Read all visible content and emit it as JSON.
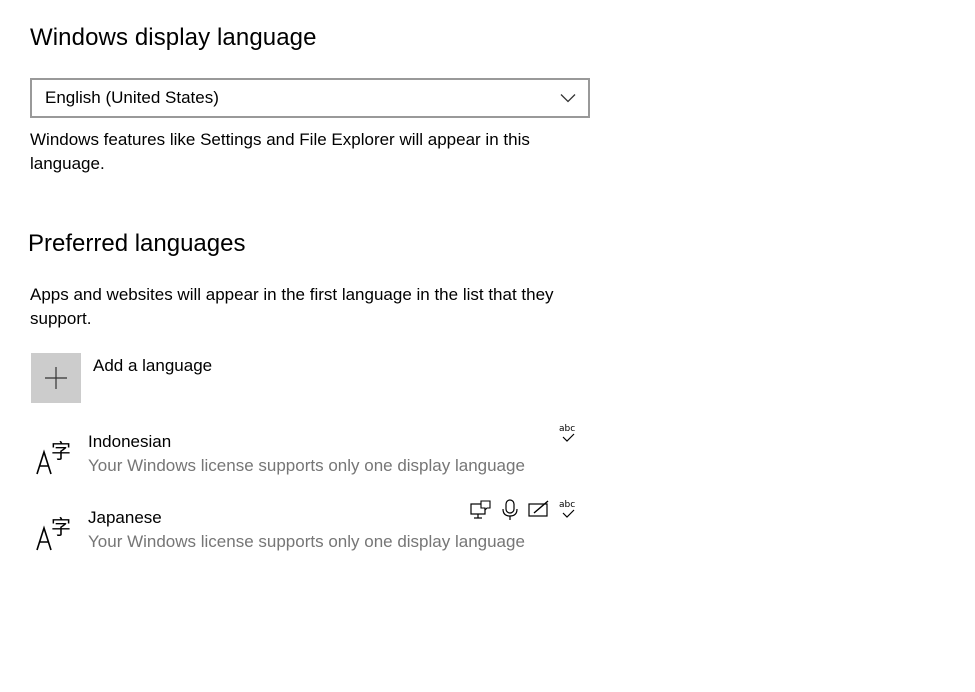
{
  "display_language": {
    "heading": "Windows display language",
    "selected": "English (United States)",
    "description": "Windows features like Settings and File Explorer will appear in this language."
  },
  "preferred_languages": {
    "heading": "Preferred languages",
    "description": "Apps and websites will appear in the first language in the list that they support.",
    "add_label": "Add a language",
    "languages": [
      {
        "name": "Indonesian",
        "note": "Your Windows license supports only one display language",
        "features": [
          "spelling-icon"
        ]
      },
      {
        "name": "Japanese",
        "note": "Your Windows license supports only one display language",
        "features": [
          "display-language-icon",
          "speech-icon",
          "handwriting-icon",
          "spelling-icon"
        ]
      }
    ]
  },
  "icons": {
    "dropdown": "chevron-down-icon",
    "add": "plus-icon",
    "language": "language-icon"
  },
  "colors": {
    "add_button_bg": "#cccccc",
    "dropdown_border": "#999999",
    "secondary_text": "#767676"
  }
}
